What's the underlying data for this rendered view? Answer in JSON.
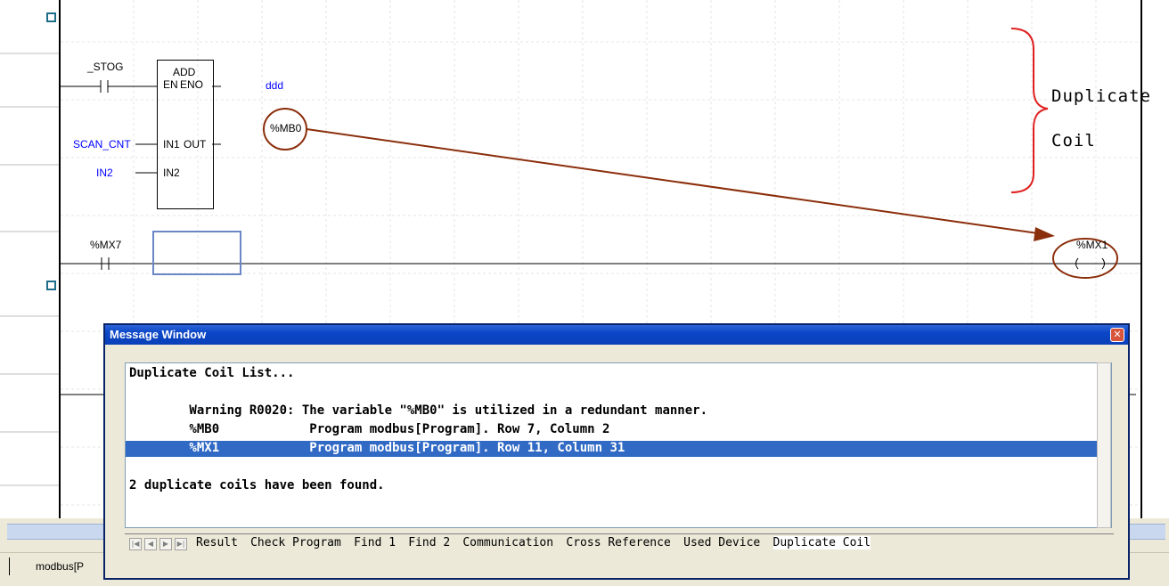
{
  "ladder": {
    "contact1_label": "_STOG",
    "fb_name": "ADD",
    "fb_en": "EN",
    "fb_eno": "ENO",
    "fb_in1": "IN1",
    "fb_out": "OUT",
    "fb_in2": "IN2",
    "eno_var": "ddd",
    "in1_var": "SCAN_CNT",
    "in2_var": "IN2",
    "out_var": "%MB0",
    "contact2_label": "%MX7",
    "coil_label": "%MX1",
    "coil_symbol": "-( )-"
  },
  "callout": {
    "line1": "Duplicate",
    "line2": "Coil"
  },
  "editor_tab": {
    "label": "modbus[P"
  },
  "message_window": {
    "title": "Message Window",
    "close_symbol": "✕",
    "lines": [
      "Duplicate Coil List...",
      "",
      "        Warning R0020: The variable \"%MB0\" is utilized in a redundant manner.",
      "        %MB0            Program modbus[Program]. Row 7, Column 2",
      "        %MX1            Program modbus[Program]. Row 11, Column 31",
      "",
      "2 duplicate coils have been found."
    ],
    "selected_line_index": 4,
    "tabs": [
      "Result",
      "Check Program",
      "Find 1",
      "Find 2",
      "Communication",
      "Cross Reference",
      "Used Device",
      "Duplicate Coil"
    ],
    "active_tab": "Duplicate Coil"
  },
  "colors": {
    "annotation": "#8b2e0b",
    "brace": "#e02020",
    "variable_blue": "#0000ff",
    "selection": "#316ac5",
    "titlebar": "#0b46c7"
  }
}
